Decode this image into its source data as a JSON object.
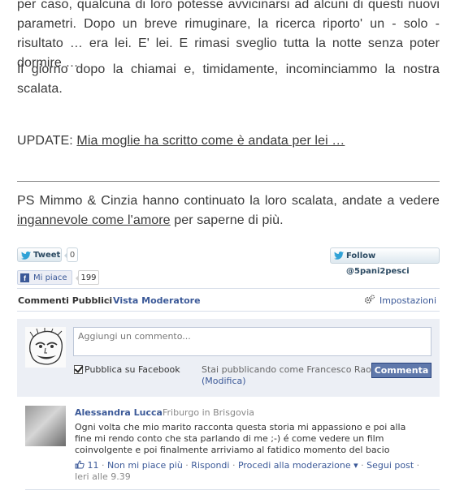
{
  "article": {
    "p1": "per caso, qualcuna di loro potesse avvicinarsi ad alcuni di questi nuovi parametri. Dopo un breve rimuginare, la ricerca riporto' un - solo - risultato … era lei. E' lei. E rimasi sveglio tutta la notte senza poter dormire …",
    "p2": "Il giorno dopo la chiamai e, timidamente, incominciammo la nostra scalata.",
    "update_prefix": "UPDATE: ",
    "update_link": "Mia moglie ha scritto come è andata per lei …",
    "p4_prefix": "PS Mimmo & Cinzia hanno continuato la loro scalata, andate a vedere ",
    "p4_link": "ingannevole come l'amore",
    "p4_suffix": " per saperne di più."
  },
  "share": {
    "tweet_label": "Tweet",
    "tweet_count": "0",
    "follow_label": "Follow @5pani2pesci",
    "like_label": "Mi piace",
    "like_count": "199",
    "fb_letter": "f"
  },
  "comments_box": {
    "tab_public": "Commenti Pubblici",
    "separator": "·",
    "tab_moderator": "Vista Moderatore",
    "settings": "Impostazioni",
    "input_placeholder": "Aggiungi un commento...",
    "publish_fb_label": "Pubblica su Facebook",
    "publish_fb_checked": true,
    "posting_as": "Stai pubblicando come Francesco Rao",
    "posting_as_edit": "(Modifica)",
    "comment_button": "Commenta",
    "accent_color": "#3b5998",
    "comments": [
      {
        "author": "Alessandra Lucca",
        "location": "· Friburgo in Brisgovia",
        "text": "Ogni volta che mio marito racconta questa storia mi appassiono e poi alla fine mi rendo conto che sta parlando di me ;-) é come vedere un film coinvolgente e poi finalmente arriviamo al fatidico momento del bacio",
        "likes": "11",
        "unlike": "Non mi piace più",
        "reply": "Rispondi",
        "moderate": "Procedi alla moderazione ▾",
        "follow": "Segui post",
        "time": "Ieri alle 9.39"
      }
    ]
  }
}
